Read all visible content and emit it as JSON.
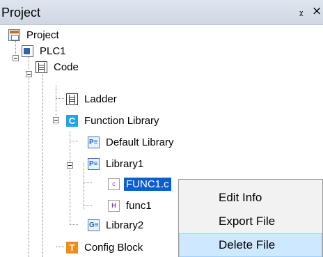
{
  "panel": {
    "title": "Project",
    "pin_glyph": "Ԅ",
    "close_glyph": "×"
  },
  "tree": {
    "project": "Project",
    "plc": "PLC1",
    "code": "Code",
    "ladder": "Ladder",
    "function_library": "Function Library",
    "default_library": "Default Library",
    "library1": "Library1",
    "func1_c": "FUNC1.c",
    "func1_h": "func1",
    "library2": "Library2",
    "config_block": "Config Block",
    "icons": {
      "c": "C",
      "p": "P≡",
      "g": "G≡",
      "file_c": "c",
      "file_h": "H",
      "t": "T"
    }
  },
  "context_menu": {
    "items": [
      "Edit Info",
      "Export File",
      "Delete File"
    ],
    "hover_index": 2,
    "hover_bg": "#cde8ff"
  }
}
